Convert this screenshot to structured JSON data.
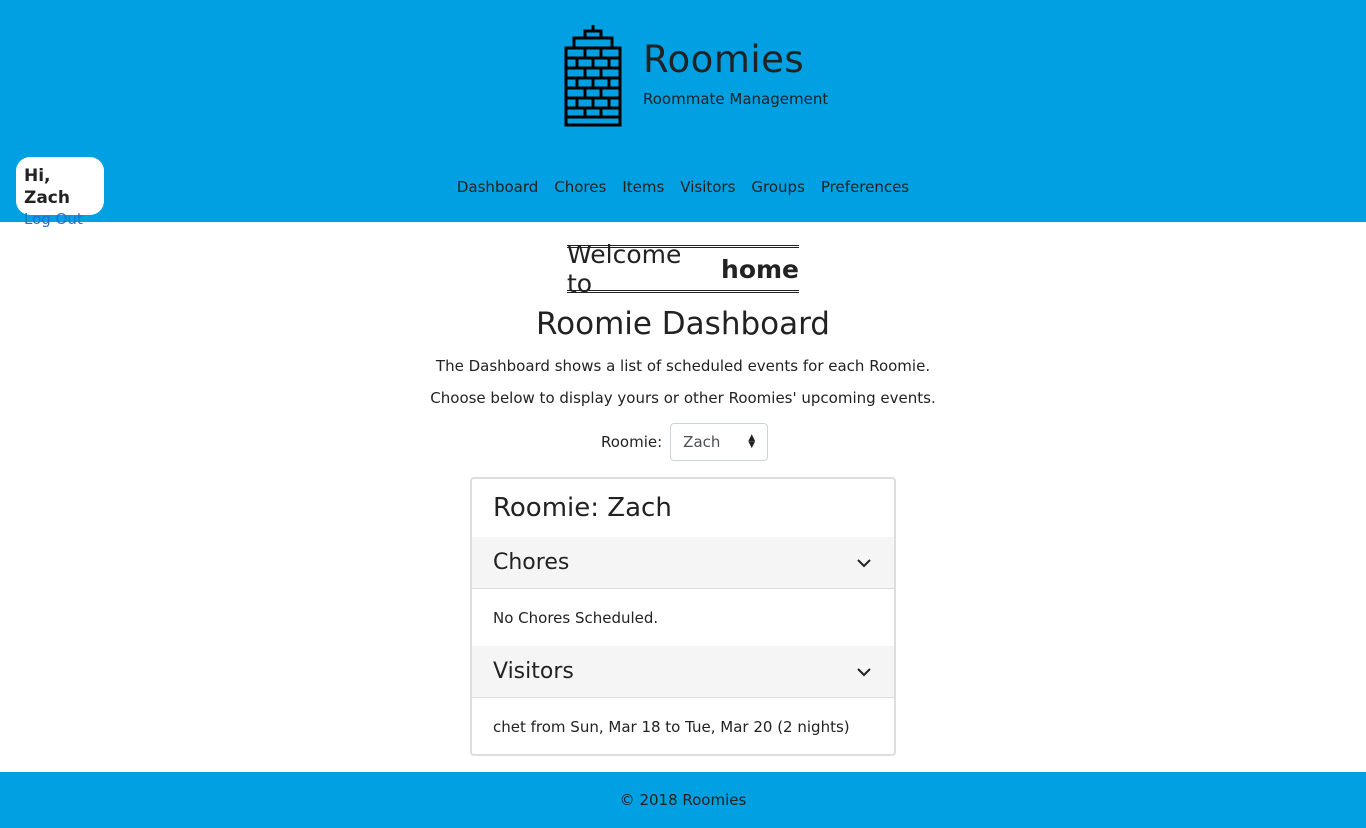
{
  "brand": {
    "title": "Roomies",
    "subtitle": "Roommate Management",
    "logo_icon": "building-icon"
  },
  "user": {
    "greeting": "Hi, Zach",
    "logout_label": "Log Out"
  },
  "nav": {
    "items": [
      "Dashboard",
      "Chores",
      "Items",
      "Visitors",
      "Groups",
      "Preferences"
    ]
  },
  "welcome": {
    "prefix": "Welcome to",
    "emphasis": "home"
  },
  "dashboard": {
    "title": "Roomie Dashboard",
    "description_1": "The Dashboard shows a list of scheduled events for each Roomie.",
    "description_2": "Choose below to display yours or other Roomies' upcoming events.",
    "select_label": "Roomie:",
    "select_value": "Zach"
  },
  "card": {
    "title": "Roomie: Zach",
    "sections": [
      {
        "heading": "Chores",
        "body": "No Chores Scheduled."
      },
      {
        "heading": "Visitors",
        "body": "chet from Sun, Mar 18 to Tue, Mar 20 (2 nights)"
      }
    ]
  },
  "footer": {
    "text": "© 2018 Roomies"
  },
  "colors": {
    "header_bg": "#00a0e3",
    "link": "#1a73c9",
    "section_bg": "#f5f5f5"
  }
}
